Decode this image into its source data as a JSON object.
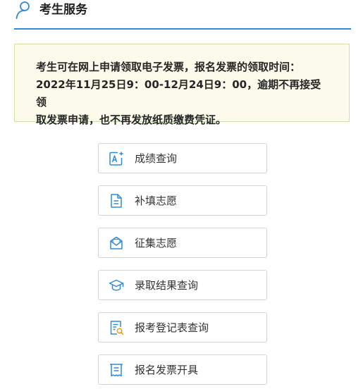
{
  "header": {
    "title": "考生服务",
    "icon": "user-icon",
    "accent_color": "#2e8bd8"
  },
  "notice": {
    "lines": [
      "考生可在网上申请领取电子发票，报名发票的领取时间：",
      "2022年11月25日9：00-12月24日9：00，逾期不再接受领",
      "取发票申请，也不再发放纸质缴费凭证。"
    ],
    "background_color": "#fbfaeb",
    "border_color": "#cfe1a6"
  },
  "services": [
    {
      "label": "成绩查询",
      "icon": "score-query-icon"
    },
    {
      "label": "补填志愿",
      "icon": "document-icon"
    },
    {
      "label": "征集志愿",
      "icon": "envelope-icon"
    },
    {
      "label": "录取结果查询",
      "icon": "graduation-cap-icon"
    },
    {
      "label": "报考登记表查询",
      "icon": "form-search-icon"
    },
    {
      "label": "报名发票开具",
      "icon": "invoice-icon"
    }
  ]
}
